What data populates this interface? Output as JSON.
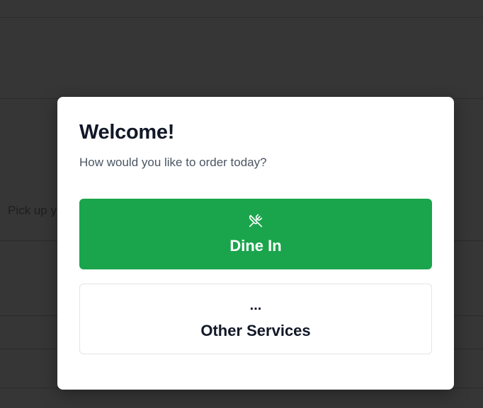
{
  "background": {
    "partial_text": "Pick up y"
  },
  "modal": {
    "title": "Welcome!",
    "subtitle": "How would you like to order today?",
    "options": [
      {
        "label": "Dine In",
        "icon": "utensils-crossed-icon"
      },
      {
        "label": "Other Services",
        "icon": "more-dots-icon",
        "icon_glyph": "..."
      }
    ]
  },
  "colors": {
    "primary": "#1aa54c",
    "backdrop": "#363636",
    "title": "#111827",
    "subtitle": "#4b5563"
  }
}
